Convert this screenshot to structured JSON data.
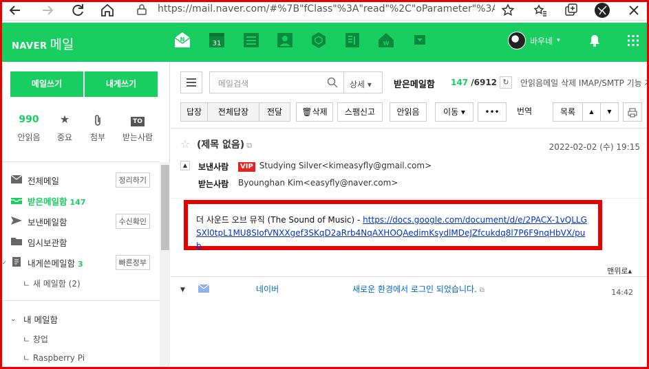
{
  "browser": {
    "url": "https://mail.naver.com/#%7B\"fClass\"%3A\"read\"%2C\"oParameter\"%3A%7B\"c...",
    "icons": [
      "back-icon",
      "forward-icon",
      "reload-icon",
      "home-icon",
      "lock-icon",
      "add-favorite-icon",
      "favorites-icon",
      "collections-icon",
      "profile-icon",
      "close-icon"
    ]
  },
  "header": {
    "logo_brand": "NAVER",
    "logo_product": "메일",
    "user_name": "바우네",
    "user_caret": "▾",
    "apps": [
      "mail-app-icon",
      "calendar-app-icon",
      "list-app-icon",
      "contacts-app-icon",
      "box-app-icon",
      "memo-app-icon",
      "home-app-icon",
      "more-app-icon"
    ],
    "calendar_day": "31"
  },
  "sidebar": {
    "write_label": "메일쓰기",
    "self_write_label": "내게쓰기",
    "quick": [
      {
        "value": "990",
        "label": "안읽음"
      },
      {
        "icon": "★",
        "label": "중요"
      },
      {
        "icon": "⚲",
        "label": "첨부"
      },
      {
        "badge": "TO",
        "label": "받는사람"
      }
    ],
    "folders": [
      {
        "label": "전체메일",
        "button": "정리하기"
      },
      {
        "label": "받은메일함",
        "count": "147"
      },
      {
        "label": "보낸메일함",
        "button": "수신확인"
      },
      {
        "label": "임시보관함"
      },
      {
        "label": "내게쓴메일함",
        "count": "3",
        "button": "빠른정부"
      },
      {
        "label": "ㄴ 새 메일함 (2)"
      }
    ],
    "my_folders_title": "내 메일함",
    "my_folders": [
      "ㄴ 창업",
      "ㄴ Raspberry Pi"
    ]
  },
  "main": {
    "search_placeholder": "메일검색",
    "search_detail": "상세 ▾",
    "inbox_title": "받은메일함",
    "unread": "147",
    "total": "/6912",
    "notice": "안읽음메일 삭제 IMAP/SMTP 기능 개선 사전 안내",
    "toolbar": {
      "reply": "답장",
      "reply_all": "전체답장",
      "forward": "전달",
      "delete": "삭제",
      "spam": "스팸신고",
      "unread": "안읽음",
      "move": "이동 ▾",
      "more": "•••",
      "translate": "번역",
      "list": "목록",
      "prev": "▲",
      "next": "▼"
    },
    "mail": {
      "subject": "(제목 없음)",
      "date": "2022-02-02 (수) 19:15",
      "from_label": "보낸사람",
      "vip": "VIP",
      "from": "Studying Silver<kimeasyfly@gmail.com>",
      "to_label": "받는사람",
      "to": "Byounghan Kim<easyfly@naver.com>",
      "body_text": "더 사운드 오브 뮤직 (The Sound of Music) - ",
      "body_link": "https://docs.google.com/document/d/e/2PACX-1vQLLGSXl0tpL1MU8SIofVNXXgef3SKqD2aRrb4NqAXHOQAedimKsydlMDeJZfcukdq8l7P6F9nqHbVX/pub"
    },
    "to_top": "맨위로▴",
    "next_mail": {
      "from": "네이버",
      "subject": "새로운 환경에서 로그인 되었습니다.",
      "time": "14:42"
    }
  },
  "colors": {
    "naver_green": "#19ce60",
    "highlight_red": "#e60000"
  }
}
